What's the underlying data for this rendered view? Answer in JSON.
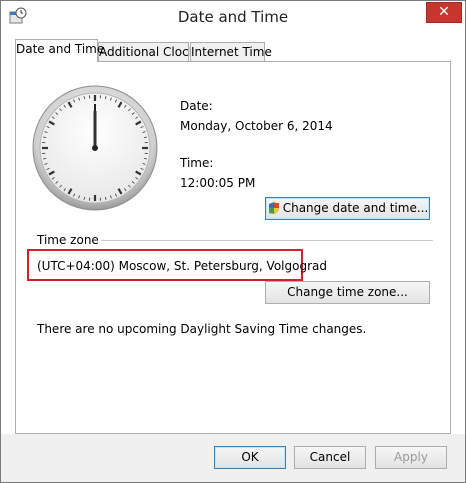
{
  "window": {
    "title": "Date and Time",
    "close_glyph": "✕"
  },
  "tabs": [
    {
      "label": "Date and Time"
    },
    {
      "label": "Additional Clocks"
    },
    {
      "label": "Internet Time"
    }
  ],
  "clock": {
    "icon": "analog-clock-icon",
    "time_shown": "12:00:05"
  },
  "date": {
    "label": "Date:",
    "value": "Monday, October 6, 2014"
  },
  "time": {
    "label": "Time:",
    "value": "12:00:05 PM"
  },
  "buttons": {
    "change_datetime": "Change date and time...",
    "change_timezone": "Change time zone...",
    "ok": "OK",
    "cancel": "Cancel",
    "apply": "Apply"
  },
  "timezone": {
    "heading": "Time zone",
    "value": "(UTC+04:00) Moscow, St. Petersburg, Volgograd",
    "dst_message": "There are no upcoming Daylight Saving Time changes."
  },
  "colors": {
    "highlight_border": "#d2202f",
    "close_button": "#c7372f"
  }
}
